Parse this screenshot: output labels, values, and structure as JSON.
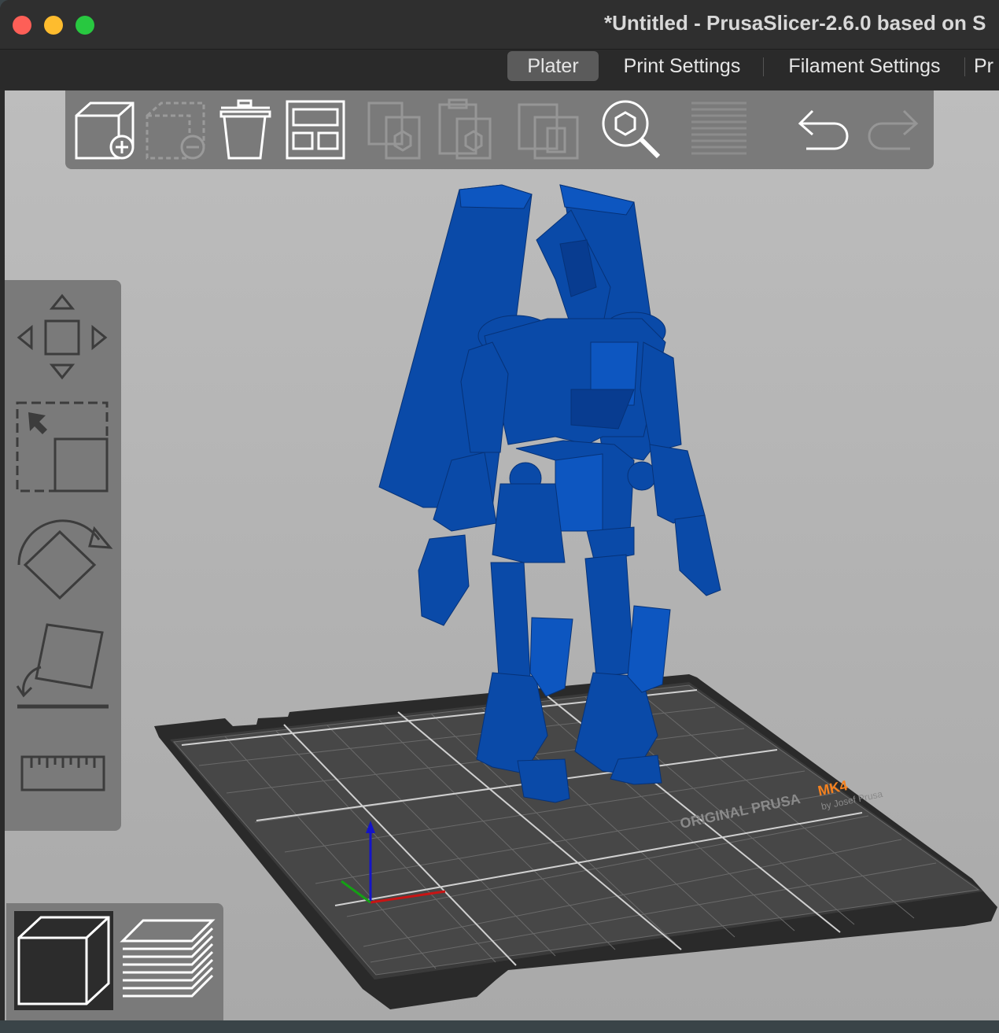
{
  "window": {
    "title": "*Untitled - PrusaSlicer-2.6.0 based on S"
  },
  "tabs": [
    {
      "label": "Plater",
      "active": true
    },
    {
      "label": "Print Settings",
      "active": false
    },
    {
      "label": "Filament Settings",
      "active": false
    },
    {
      "label": "Pr",
      "active": false
    }
  ],
  "toolbar": {
    "buttons": [
      {
        "icon": "add-object-icon",
        "enabled": true
      },
      {
        "icon": "delete-object-icon",
        "enabled": false
      },
      {
        "icon": "delete-all-icon",
        "enabled": true
      },
      {
        "icon": "arrange-icon",
        "enabled": true
      },
      {
        "icon": "copy-icon",
        "enabled": false
      },
      {
        "icon": "paste-icon",
        "enabled": false
      },
      {
        "icon": "add-instance-icon",
        "enabled": false
      },
      {
        "icon": "search-icon",
        "enabled": true
      },
      {
        "icon": "layers-editing-icon",
        "enabled": false
      },
      {
        "icon": "undo-icon",
        "enabled": true
      },
      {
        "icon": "redo-icon",
        "enabled": false
      }
    ]
  },
  "gizmos": [
    {
      "icon": "move-icon"
    },
    {
      "icon": "scale-icon"
    },
    {
      "icon": "rotate-icon"
    },
    {
      "icon": "place-on-face-icon"
    },
    {
      "icon": "measure-icon"
    }
  ],
  "view_toggle": {
    "options": [
      {
        "icon": "3d-view-icon",
        "active": true
      },
      {
        "icon": "preview-layers-icon",
        "active": false
      }
    ]
  },
  "bed": {
    "brand_line1": "ORIGINAL PRUSA",
    "brand_model": "MK4",
    "brand_line2": "by Josef Prusa"
  },
  "colors": {
    "model": "#0a4aa8",
    "model_shadow": "#073a88",
    "accent_orange": "#f58220"
  }
}
